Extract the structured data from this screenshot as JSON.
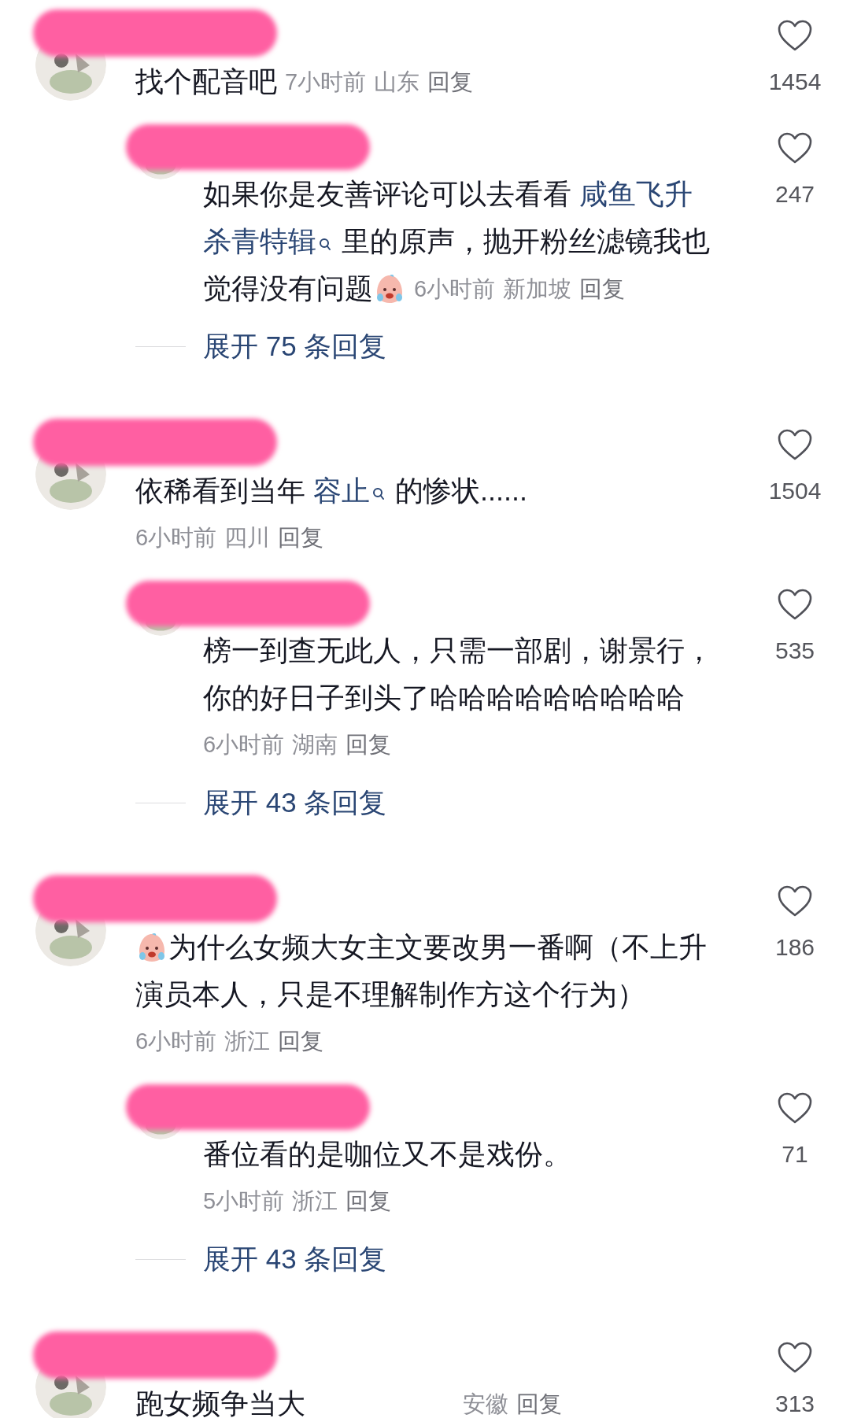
{
  "comments": [
    {
      "kind": "comment",
      "lines": [
        [
          {
            "kind": "text",
            "text": "找个配音吧"
          }
        ]
      ],
      "time": "7小时前",
      "location": "山东",
      "reply": "回复",
      "meta_below": false,
      "likes": "1454"
    },
    {
      "kind": "reply",
      "lines": [
        [
          {
            "kind": "text",
            "text": "如果你是友善评论可以去看看 "
          },
          {
            "kind": "link",
            "text": "咸鱼飞升"
          }
        ],
        [
          {
            "kind": "link",
            "text": "杀青特辑"
          },
          {
            "kind": "search"
          },
          {
            "kind": "text",
            "text": " 里的原声，抛开粉丝滤镜我也"
          }
        ],
        [
          {
            "kind": "text",
            "text": "觉得没有问题"
          },
          {
            "kind": "emoji"
          }
        ]
      ],
      "time": "6小时前",
      "location": "新加坡",
      "reply": "回复",
      "meta_below": false,
      "likes": "247",
      "expand": "展开 75 条回复"
    },
    {
      "kind": "comment",
      "lines": [
        [
          {
            "kind": "text",
            "text": "依稀看到当年 "
          },
          {
            "kind": "link",
            "text": "容止"
          },
          {
            "kind": "search"
          },
          {
            "kind": "text",
            "text": " 的惨状......"
          }
        ]
      ],
      "time": "6小时前",
      "location": "四川",
      "reply": "回复",
      "meta_below": true,
      "likes": "1504"
    },
    {
      "kind": "reply",
      "lines": [
        [
          {
            "kind": "text",
            "text": "榜一到查无此人，只需一部剧，谢景行，"
          }
        ],
        [
          {
            "kind": "text",
            "text": "你的好日子到头了哈哈哈哈哈哈哈哈哈"
          }
        ]
      ],
      "time": "6小时前",
      "location": "湖南",
      "reply": "回复",
      "meta_below": true,
      "likes": "535",
      "expand": "展开 43 条回复"
    },
    {
      "kind": "comment",
      "lines": [
        [
          {
            "kind": "emoji"
          },
          {
            "kind": "text",
            "text": "为什么女频大女主文要改男一番啊（不上升"
          }
        ],
        [
          {
            "kind": "text",
            "text": "演员本人，只是不理解制作方这个行为）"
          }
        ]
      ],
      "time": "6小时前",
      "location": "浙江",
      "reply": "回复",
      "meta_below": true,
      "likes": "186"
    },
    {
      "kind": "reply",
      "lines": [
        [
          {
            "kind": "text",
            "text": "番位看的是咖位又不是戏份。"
          }
        ]
      ],
      "time": "5小时前",
      "location": "浙江",
      "reply": "回复",
      "meta_below": true,
      "likes": "71",
      "expand": "展开 43 条回复"
    },
    {
      "kind": "comment",
      "lines": [
        [
          {
            "kind": "text",
            "text": "跑女频争当大"
          }
        ]
      ],
      "location": "安徽",
      "reply": "回复",
      "meta_below": false,
      "likes": "313"
    }
  ]
}
